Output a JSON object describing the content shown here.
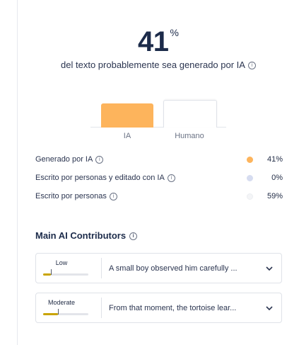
{
  "summary": {
    "percent_value": "41",
    "percent_sign": "%",
    "subtitle": "del texto probablemente sea generado por IA"
  },
  "chart_data": {
    "type": "bar",
    "categories": [
      "IA",
      "Humano"
    ],
    "values": [
      41,
      59
    ],
    "colors": [
      "#fdb45c",
      "#ffffff"
    ]
  },
  "breakdown": [
    {
      "label": "Generado por IA",
      "value": "41%",
      "color": "#fdb45c"
    },
    {
      "label": "Escrito por personas y editado con IA",
      "value": "0%",
      "color": "#d6dcf0"
    },
    {
      "label": "Escrito por personas",
      "value": "59%",
      "color": "#f4f5f7"
    }
  ],
  "contributors": {
    "title": "Main AI Contributors",
    "items": [
      {
        "level": "Low",
        "level_fraction": 0.3,
        "text": "A small boy observed him carefully ..."
      },
      {
        "level": "Moderate",
        "level_fraction": 0.6,
        "text": "From that moment, the tortoise lear..."
      }
    ]
  },
  "icons": {
    "info": "info-icon",
    "expand": "chevron-down-icon"
  }
}
